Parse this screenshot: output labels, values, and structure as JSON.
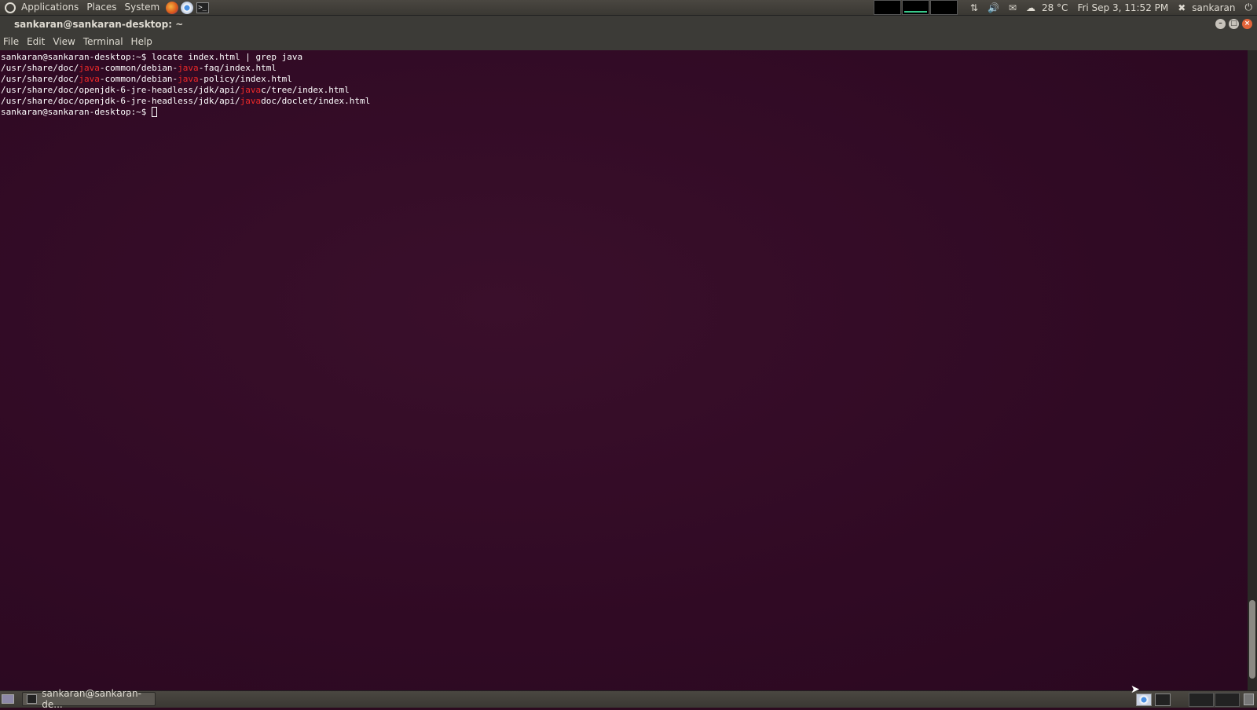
{
  "top_panel": {
    "menus": [
      "Applications",
      "Places",
      "System"
    ],
    "temperature": "28 °C",
    "datetime": "Fri Sep 3, 11:52 PM",
    "user": "sankaran"
  },
  "window": {
    "title": "sankaran@sankaran-desktop: ~",
    "menu": [
      "File",
      "Edit",
      "View",
      "Terminal",
      "Help"
    ]
  },
  "terminal": {
    "lines": [
      [
        {
          "t": "sankaran@sankaran-desktop:~$ locate index.html | grep java"
        }
      ],
      [
        {
          "t": "/usr/share/doc/"
        },
        {
          "t": "java",
          "hl": true
        },
        {
          "t": "-common/debian-"
        },
        {
          "t": "java",
          "hl": true
        },
        {
          "t": "-faq/index.html"
        }
      ],
      [
        {
          "t": "/usr/share/doc/"
        },
        {
          "t": "java",
          "hl": true
        },
        {
          "t": "-common/debian-"
        },
        {
          "t": "java",
          "hl": true
        },
        {
          "t": "-policy/index.html"
        }
      ],
      [
        {
          "t": "/usr/share/doc/openjdk-6-jre-headless/jdk/api/"
        },
        {
          "t": "java",
          "hl": true
        },
        {
          "t": "c/tree/index.html"
        }
      ],
      [
        {
          "t": "/usr/share/doc/openjdk-6-jre-headless/jdk/api/"
        },
        {
          "t": "java",
          "hl": true
        },
        {
          "t": "doc/doclet/index.html"
        }
      ]
    ],
    "prompt": "sankaran@sankaran-desktop:~$ ",
    "highlight_color": "#ef2929",
    "background_color": "#300a24"
  },
  "bottom_panel": {
    "task_label": "sankaran@sankaran-de..."
  }
}
